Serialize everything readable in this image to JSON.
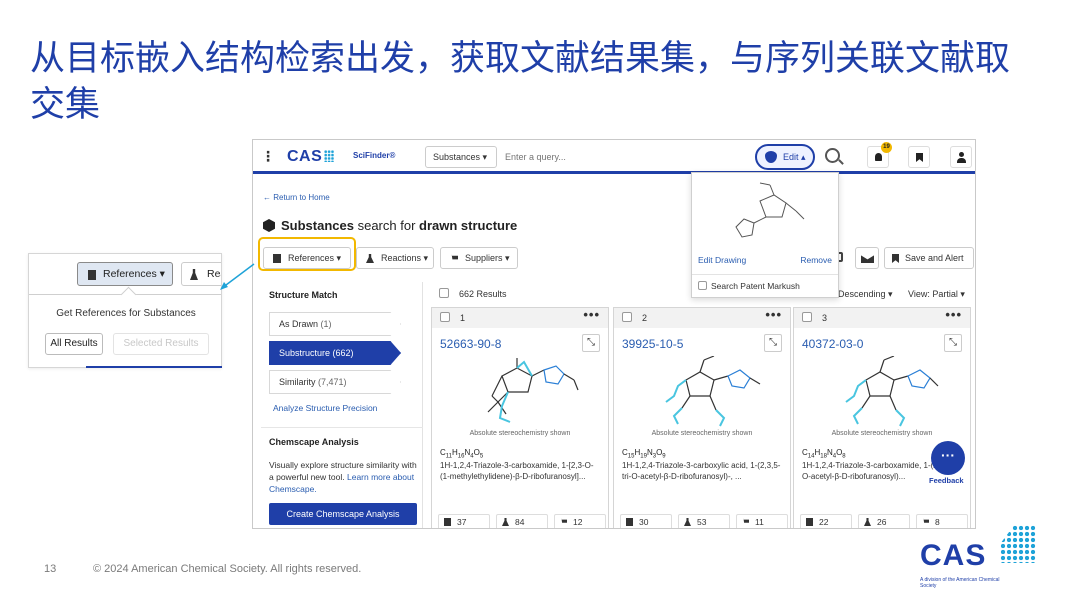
{
  "slide": {
    "title": "从目标嵌入结构检索出发，获取文献结果集，与序列关联文献取交集",
    "page_number": "13",
    "copyright": "© 2024 American Chemical Society. All rights reserved."
  },
  "app": {
    "logo": "CAS",
    "product": "SciFinder®",
    "scope_select": "Substances ▾",
    "query_placeholder": "Enter a query...",
    "edit_label": "Edit ▴",
    "notification_count": "19",
    "icons": {
      "menu": "menu-dots-icon",
      "search": "search-icon",
      "notifications": "bell-icon",
      "bookmarks": "bookmark-icon",
      "account": "user-icon"
    }
  },
  "page": {
    "return_link": "← Return to Home",
    "heading_prefix": "Substances",
    "heading_mid": " search for ",
    "heading_suffix": "drawn structure"
  },
  "toolbar": {
    "references": "References ▾",
    "reactions": "Reactions ▾",
    "suppliers": "Suppliers ▾",
    "save_alert": "Save and Alert"
  },
  "left_panel": {
    "title": "Structure Match",
    "items": [
      {
        "label": "As Drawn",
        "count": "(1)"
      },
      {
        "label": "Substructure",
        "count": "(662)"
      },
      {
        "label": "Similarity",
        "count": "(7,471)"
      }
    ],
    "analyze_link": "Analyze Structure Precision",
    "chemscape_title": "Chemscape Analysis",
    "chemscape_text": "Visually explore structure similarity with a powerful new tool.",
    "chemscape_link": "Learn more about Chemscape.",
    "chemscape_button": "Create Chemscape Analysis"
  },
  "results": {
    "count": "662 Results",
    "sort": "Descending ▾",
    "view_label": "View:",
    "view_value": "Partial ▾",
    "stereo_note": "Absolute stereochemistry shown",
    "cards": [
      {
        "index": "1",
        "cas_rn": "52663-90-8",
        "formula_parts": [
          "C",
          "11",
          "H",
          "16",
          "N",
          "4",
          "O",
          "5",
          "",
          ""
        ],
        "name": "1H-1,2,4-Triazole-3-carboxamide, 1-[2,3-O-(1-methylethylidene)-β-D-ribofuranosyl]...",
        "refs": "37",
        "reactions": "84",
        "suppliers": "12"
      },
      {
        "index": "2",
        "cas_rn": "39925-10-5",
        "formula_parts": [
          "C",
          "15",
          "H",
          "19",
          "N",
          "3",
          "O",
          "9",
          "",
          ""
        ],
        "name": "1H-1,2,4-Triazole-3-carboxylic acid, 1-(2,3,5-tri-O-acetyl-β-D-ribofuranosyl)-, ...",
        "refs": "30",
        "reactions": "53",
        "suppliers": "11"
      },
      {
        "index": "3",
        "cas_rn": "40372-03-0",
        "formula_parts": [
          "C",
          "14",
          "H",
          "18",
          "N",
          "4",
          "O",
          "8",
          "",
          ""
        ],
        "name": "1H-1,2,4-Triazole-3-carboxamide, 1-(2,3,5-tri-O-acetyl-β-D-ribofuranosyl)...",
        "refs": "22",
        "reactions": "26",
        "suppliers": "8"
      }
    ],
    "feedback": "Feedback"
  },
  "edit_popover": {
    "edit_drawing": "Edit Drawing",
    "remove": "Remove",
    "markush": "Search Patent Markush"
  },
  "zoom": {
    "references": "References ▾",
    "reactions": "Rea",
    "dropdown_title": "Get References for Substances",
    "all_results": "All Results",
    "selected_results": "Selected Results"
  },
  "footer_logo": {
    "word": "CAS",
    "tagline": "A division of the American Chemical Society"
  },
  "colors": {
    "brand_blue": "#1f3fa8",
    "link_blue": "#2a5db0",
    "highlight_yellow": "#f2b800",
    "accent_cyan": "#1fa3d8"
  }
}
